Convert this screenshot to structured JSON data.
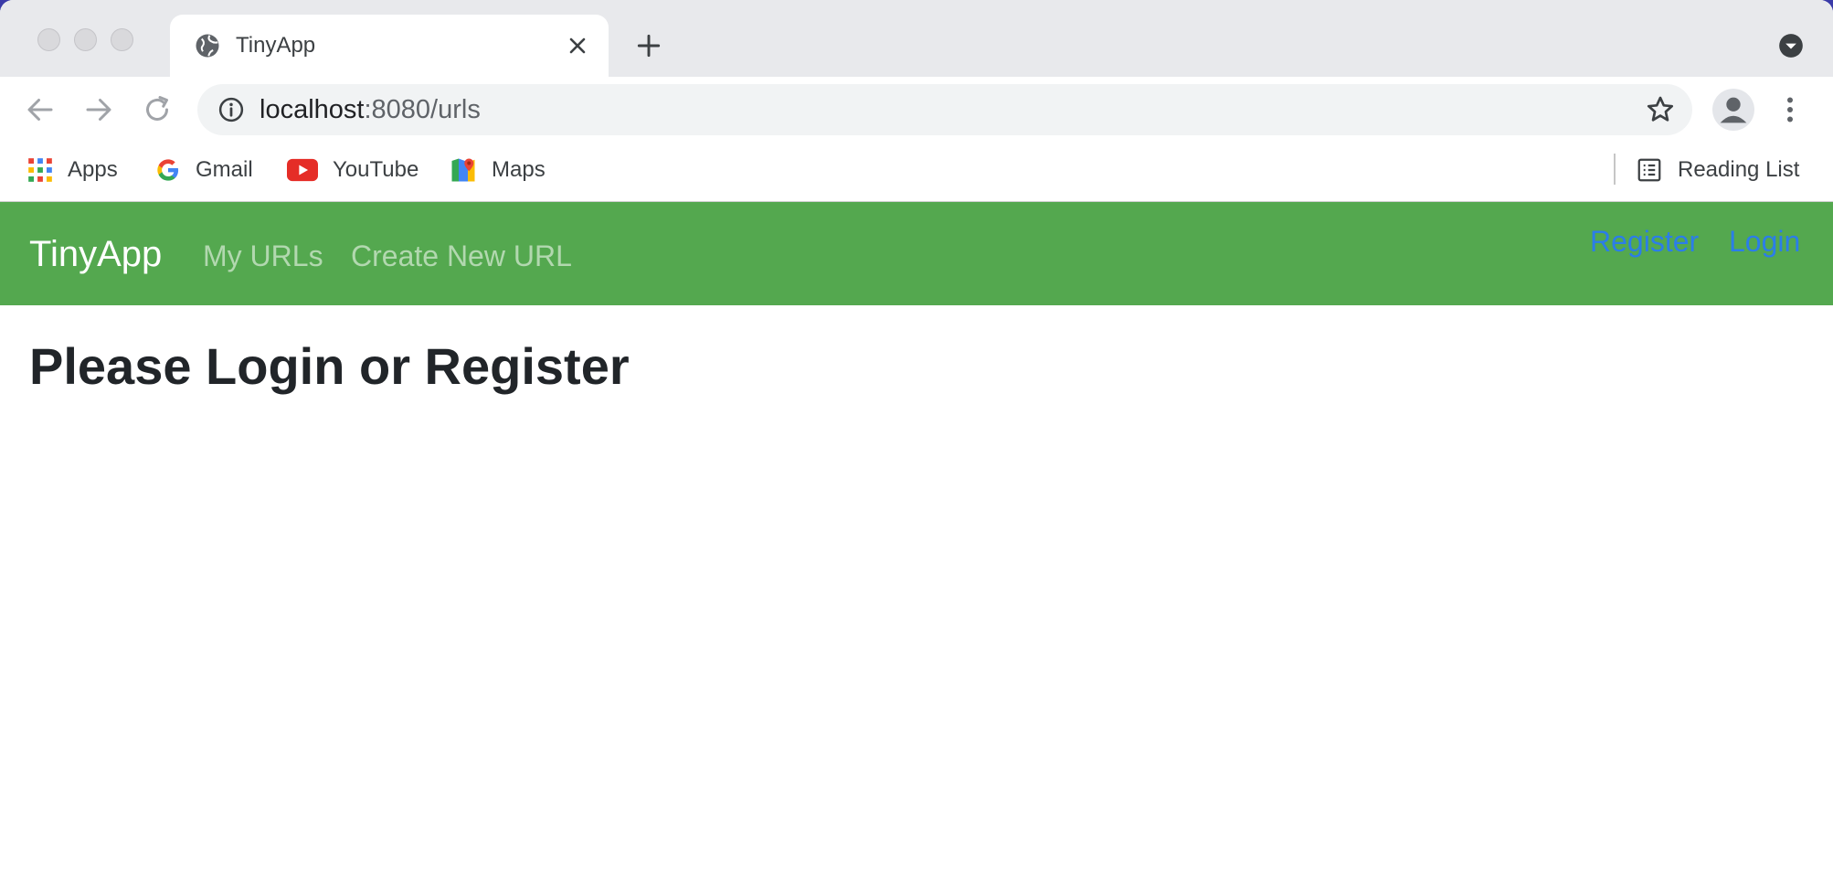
{
  "browser": {
    "tab": {
      "title": "TinyApp",
      "icon": "globe-icon"
    },
    "address_bar": {
      "host": "localhost",
      "rest": ":8080/urls"
    },
    "bookmarks": [
      {
        "label": "Apps",
        "icon": "apps-grid-icon"
      },
      {
        "label": "Gmail",
        "icon": "google-icon"
      },
      {
        "label": "YouTube",
        "icon": "youtube-icon"
      },
      {
        "label": "Maps",
        "icon": "maps-icon"
      }
    ],
    "reading_list": {
      "label": "Reading List",
      "icon": "reading-list-icon"
    }
  },
  "app": {
    "brand": "TinyApp",
    "nav": [
      {
        "label": "My URLs"
      },
      {
        "label": "Create New URL"
      }
    ],
    "auth": [
      {
        "label": "Register"
      },
      {
        "label": "Login"
      }
    ],
    "heading": "Please Login or Register"
  },
  "colors": {
    "navbar": "#54a84f",
    "auth_link": "#2b7de9",
    "heading": "#212529"
  }
}
